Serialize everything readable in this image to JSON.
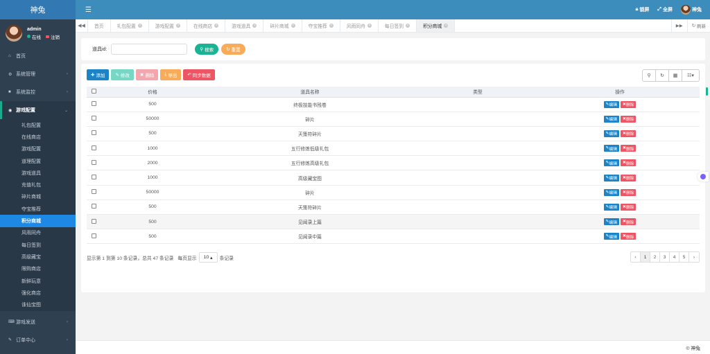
{
  "app": {
    "brand": "神兔"
  },
  "user": {
    "name": "admin",
    "online_label": "在线",
    "logout_label": "注销"
  },
  "sidebar": {
    "items": [
      {
        "label": "首页",
        "icon": "home-icon"
      },
      {
        "label": "系统管理",
        "icon": "gear-icon"
      },
      {
        "label": "系统监控",
        "icon": "monitor-icon"
      },
      {
        "label": "游戏配置",
        "icon": "gamepad-icon"
      }
    ],
    "sub_items": [
      "礼包配置",
      "在线商店",
      "游戏配置",
      "道理配置",
      "游戏道具",
      "充值礼包",
      "碎片商城",
      "夺宝推荐",
      "积分商城",
      "风雨同舟",
      "每日签到",
      "高级藏宝",
      "限购商店",
      "新鲜玩意",
      "强化商店",
      "诛仙宝图"
    ],
    "bottom_items": [
      {
        "label": "游戏发送",
        "icon": "keyboard-icon"
      },
      {
        "label": "订单中心",
        "icon": "pen-icon"
      }
    ]
  },
  "header": {
    "lock_label": "锁屏",
    "fullscreen_label": "全屏",
    "username": "神兔"
  },
  "tabs": [
    "首页",
    "礼包配置",
    "游戏配置",
    "在线商店",
    "游戏道具",
    "碎片商城",
    "夺宝推荐",
    "风雨同舟",
    "每日签到",
    "积分商城"
  ],
  "tabs_refresh_label": "刷新",
  "search": {
    "label": "道具id:",
    "value": "",
    "placeholder": "",
    "search_button": "搜索",
    "reset_button": "重置"
  },
  "toolbar": {
    "add": "添加",
    "edit": "修改",
    "delete": "删除",
    "export": "导出",
    "sync": "同步数据"
  },
  "table": {
    "columns": [
      "价格",
      "道具名称",
      "类型",
      "操作"
    ],
    "edit_label": "编辑",
    "delete_label": "删除",
    "rows": [
      {
        "price": "500",
        "name": "终极技能书残卷",
        "type": ""
      },
      {
        "price": "50000",
        "name": "碎片",
        "type": ""
      },
      {
        "price": "500",
        "name": "天策符碎片",
        "type": ""
      },
      {
        "price": "1000",
        "name": "五行修炼低级礼包",
        "type": ""
      },
      {
        "price": "2000",
        "name": "五行修炼高级礼包",
        "type": ""
      },
      {
        "price": "1000",
        "name": "高级藏宝图",
        "type": ""
      },
      {
        "price": "50000",
        "name": "碎片",
        "type": ""
      },
      {
        "price": "500",
        "name": "天策符碎片",
        "type": ""
      },
      {
        "price": "500",
        "name": "见闻录上篇",
        "type": ""
      },
      {
        "price": "500",
        "name": "见闻录中篇",
        "type": ""
      }
    ]
  },
  "pagination": {
    "info": "显示第 1 到第 10 条记录，总共 47 条记录",
    "per_page_prefix": "每页显示",
    "per_page": "10",
    "per_page_suffix": "条记录",
    "prev": "‹",
    "pages": [
      "1",
      "2",
      "3",
      "4",
      "5"
    ],
    "next": "›",
    "current": "1"
  },
  "footer": {
    "copyright": "© 神兔"
  },
  "colors": {
    "sidebar": "#2f4050",
    "header": "#3c8dbc",
    "accent": "#1e88e5",
    "green": "#1ab394",
    "red": "#ed5565"
  }
}
